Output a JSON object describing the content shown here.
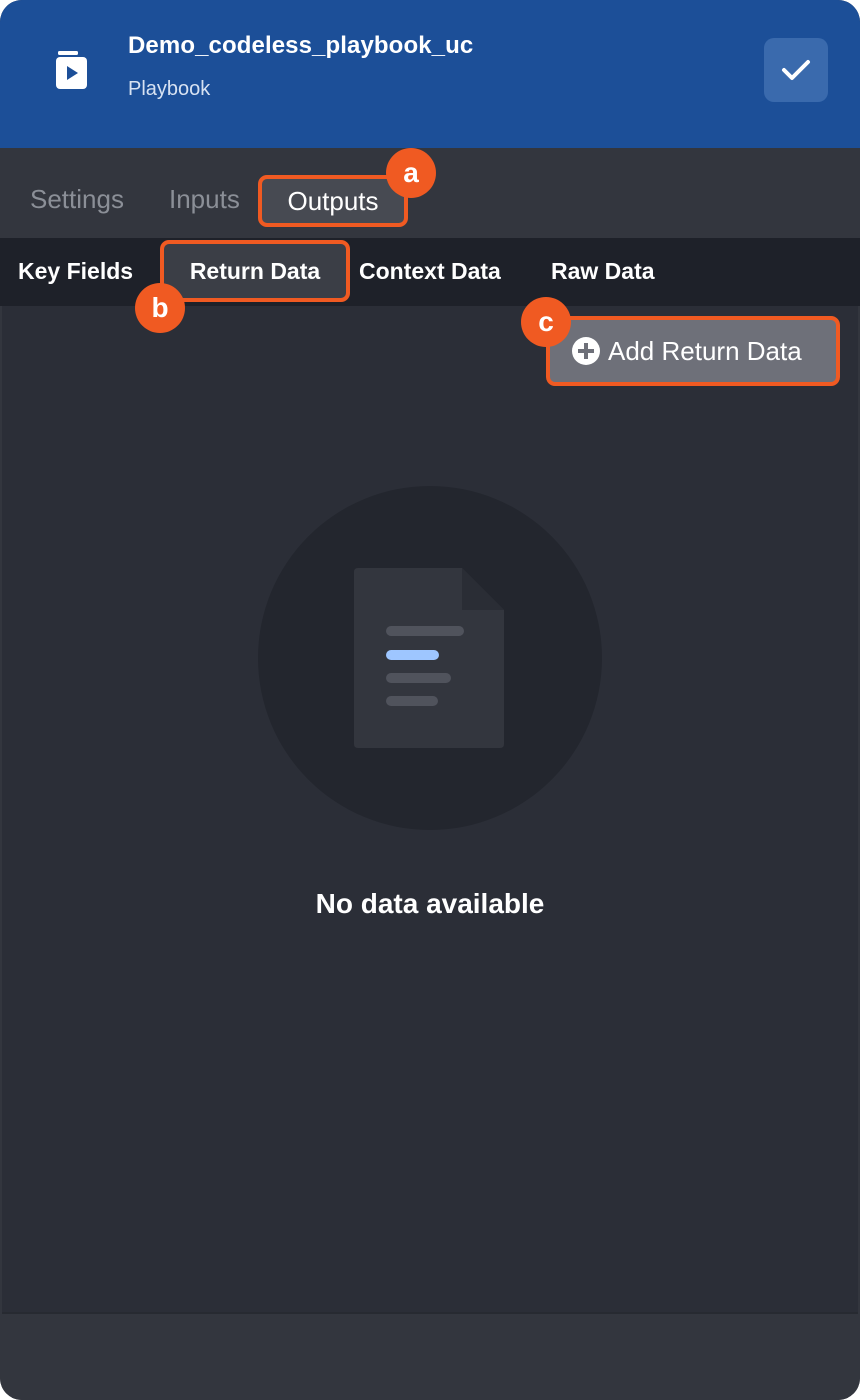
{
  "header": {
    "title": "Demo_codeless_playbook_uc",
    "subtitle": "Playbook",
    "icon": "playbook-icon",
    "confirm_icon": "checkmark-icon"
  },
  "main_tabs": [
    {
      "label": "Settings",
      "active": false
    },
    {
      "label": "Inputs",
      "active": false
    },
    {
      "label": "Outputs",
      "active": true
    }
  ],
  "sub_tabs": [
    {
      "label": "Key Fields",
      "active": false
    },
    {
      "label": "Return Data",
      "active": true
    },
    {
      "label": "Context Data",
      "active": false
    },
    {
      "label": "Raw Data",
      "active": false
    }
  ],
  "actions": {
    "add_return_data": "Add Return Data"
  },
  "empty_state": {
    "icon": "document-icon",
    "message": "No data available"
  },
  "annotations": {
    "a": "a",
    "b": "b",
    "c": "c"
  },
  "colors": {
    "header_bg": "#1c4f98",
    "highlight": "#f05a22",
    "panel_bg": "#33363e",
    "content_bg": "#2b2e37"
  }
}
